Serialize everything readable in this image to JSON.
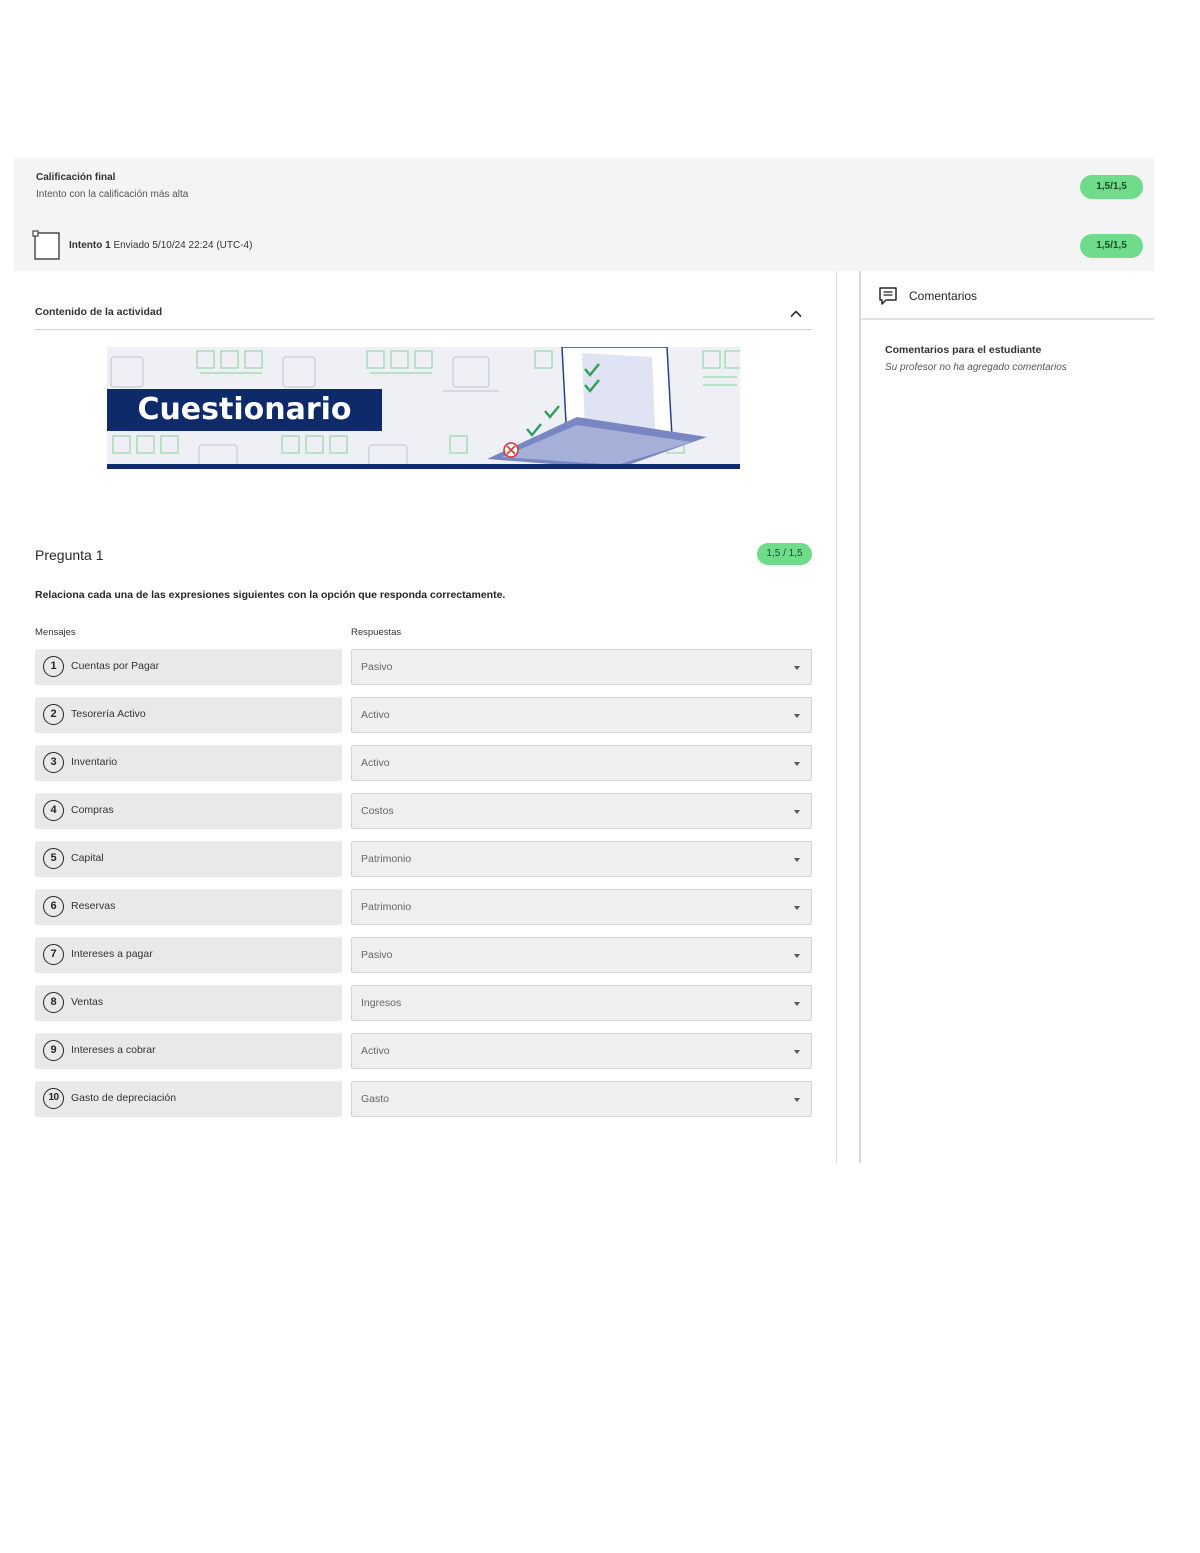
{
  "grade_summary": {
    "final_title": "Calificación final",
    "final_subtitle": "Intento con la calificación más alta",
    "final_score": "1,5/1,5",
    "attempt_label": "Intento 1",
    "attempt_submitted": "Enviado 5/10/24 22:24 (UTC-4)",
    "attempt_score": "1,5/1,5",
    "score_color": "#6fdc8c"
  },
  "activity": {
    "section_title": "Contenido de la actividad",
    "banner_title": "Cuestionario"
  },
  "question": {
    "title": "Pregunta 1",
    "score": "1,5 / 1,5",
    "prompt": "Relaciona cada una de las expresiones siguientes con la opción que responda correctamente.",
    "col_messages": "Mensajes",
    "col_answers": "Respuestas",
    "rows": [
      {
        "num": "1",
        "message": "Cuentas por Pagar",
        "answer": "Pasivo"
      },
      {
        "num": "2",
        "message": "Tesorería Activo",
        "answer": "Activo"
      },
      {
        "num": "3",
        "message": "Inventario",
        "answer": "Activo"
      },
      {
        "num": "4",
        "message": "Compras",
        "answer": "Costos"
      },
      {
        "num": "5",
        "message": "Capital",
        "answer": "Patrimonio"
      },
      {
        "num": "6",
        "message": "Reservas",
        "answer": "Patrimonio"
      },
      {
        "num": "7",
        "message": "Intereses a pagar",
        "answer": "Pasivo"
      },
      {
        "num": "8",
        "message": "Ventas",
        "answer": "Ingresos"
      },
      {
        "num": "9",
        "message": "Intereses a cobrar",
        "answer": "Activo"
      },
      {
        "num": "10",
        "message": "Gasto de depreciación",
        "answer": "Gasto"
      }
    ]
  },
  "comments": {
    "title": "Comentarios",
    "feedback_title": "Comentarios para el estudiante",
    "feedback_empty": "Su profesor no ha agregado comentarios"
  },
  "icons": {
    "attempt": "document-icon",
    "collapse": "chevron-up-icon",
    "comments": "comment-icon",
    "dropdown": "caret-down-icon"
  }
}
